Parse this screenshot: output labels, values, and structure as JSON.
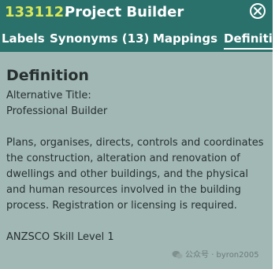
{
  "window": {
    "code": "133112.",
    "title": "Project Builder",
    "close_icon": "close-circle-icon"
  },
  "tabs": [
    {
      "label": "Labels"
    },
    {
      "label": "Synonyms (13)"
    },
    {
      "label": "Mappings"
    },
    {
      "label": "Definition",
      "active": true
    }
  ],
  "definition": {
    "heading": "Definition",
    "alt_title_label": "Alternative Title:",
    "alt_title_value": "Professional Builder",
    "description": "Plans, organises, directs, controls and coordinates the construction, alteration and renovation of dwellings and other buildings, and the physical and human resources involved in the building process. Registration or licensing is required.",
    "skill_level": "ANZSCO Skill Level 1"
  },
  "watermark": {
    "text": "公众号 · byron2005",
    "icon": "wechat-icon"
  },
  "colors": {
    "header_bg": "#2a716c",
    "code_accent": "#d8e65a",
    "panel_bg": "#a2b8b5",
    "text": "#26302f"
  }
}
